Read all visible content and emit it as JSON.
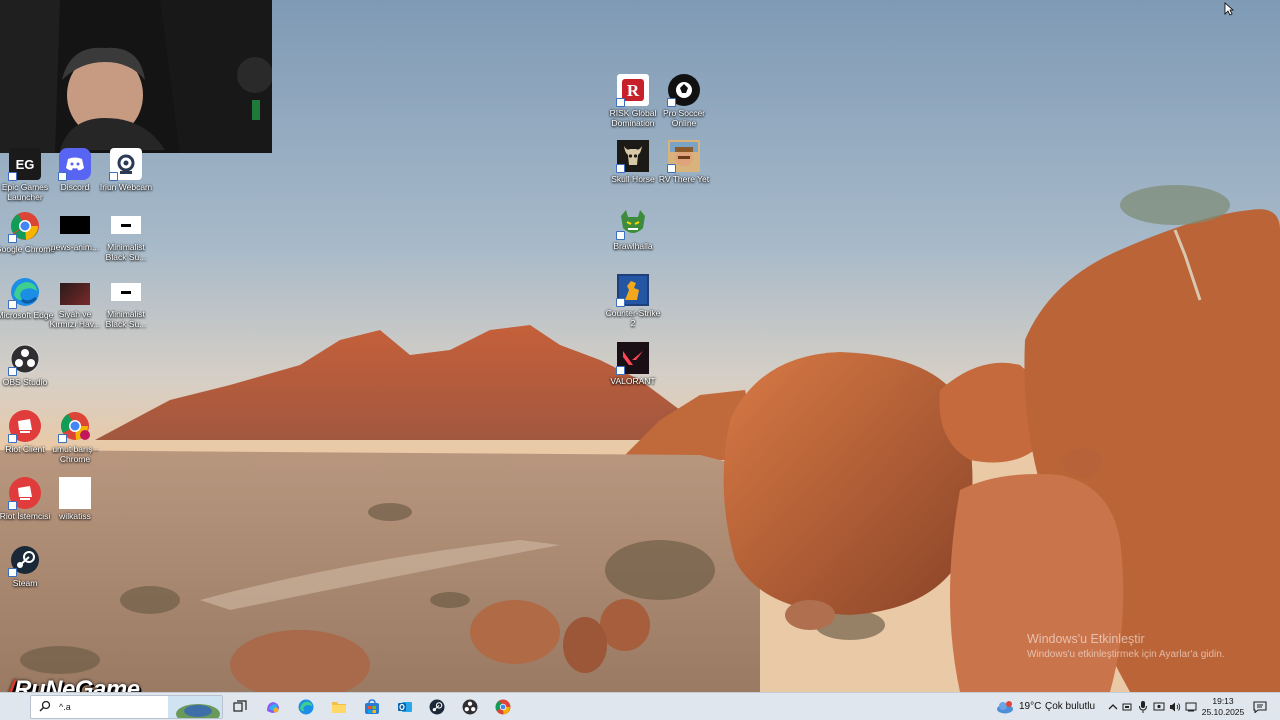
{
  "desktop_icons": [
    {
      "label": "Epic Games Launcher",
      "icon": "epic-games-icon"
    },
    {
      "label": "Discord",
      "icon": "discord-icon"
    },
    {
      "label": "Iriun Webcam",
      "icon": "iriun-webcam-icon"
    },
    {
      "label": "Google Chrome",
      "icon": "chrome-icon"
    },
    {
      "label": "news-anim...",
      "icon": "file-thumbnail-icon"
    },
    {
      "label": "Minimalist Black Su...",
      "icon": "file-thumbnail-icon"
    },
    {
      "label": "Microsoft Edge",
      "icon": "edge-icon"
    },
    {
      "label": "Siyah ve Kırmızı Hav...",
      "icon": "image-thumbnail-icon"
    },
    {
      "label": "Minimalist Black Su...",
      "icon": "file-thumbnail-icon"
    },
    {
      "label": "OBS Studio",
      "icon": "obs-icon"
    },
    {
      "label": "Riot Client",
      "icon": "riot-client-icon"
    },
    {
      "label": "umut barış - Chrome",
      "icon": "chrome-profile-icon"
    },
    {
      "label": "Riot İstemcisi",
      "icon": "riot-client-icon"
    },
    {
      "label": "wilkatiss",
      "icon": "blank-file-icon"
    },
    {
      "label": "Steam",
      "icon": "steam-icon"
    },
    {
      "label": "RISK Global Domination",
      "icon": "risk-icon"
    },
    {
      "label": "Pro Soccer Online",
      "icon": "pro-soccer-icon"
    },
    {
      "label": "Skull Horse",
      "icon": "skull-horse-icon"
    },
    {
      "label": "RV There Yet",
      "icon": "rv-there-yet-icon"
    },
    {
      "label": "Brawlhalla",
      "icon": "brawlhalla-icon"
    },
    {
      "label": "Counter-Strike 2",
      "icon": "counter-strike-icon"
    },
    {
      "label": "VALORANT",
      "icon": "valorant-icon"
    }
  ],
  "watermark": {
    "title": "Windows'u Etkinleştir",
    "subtitle": "Windows'u etkinleştirmek için Ayarlar'a gidin."
  },
  "logo_text": "RuNeGame",
  "taskbar": {
    "search_value": "^.a",
    "pinned": [
      "task-view-icon",
      "copilot-icon",
      "edge-icon",
      "file-explorer-icon",
      "microsoft-store-icon",
      "outlook-icon",
      "steam-icon",
      "obs-icon",
      "chrome-icon"
    ],
    "weather_temp": "19°C",
    "weather_desc": "Çok bulutlu",
    "time": "19:13",
    "date": "25.10.2025"
  }
}
